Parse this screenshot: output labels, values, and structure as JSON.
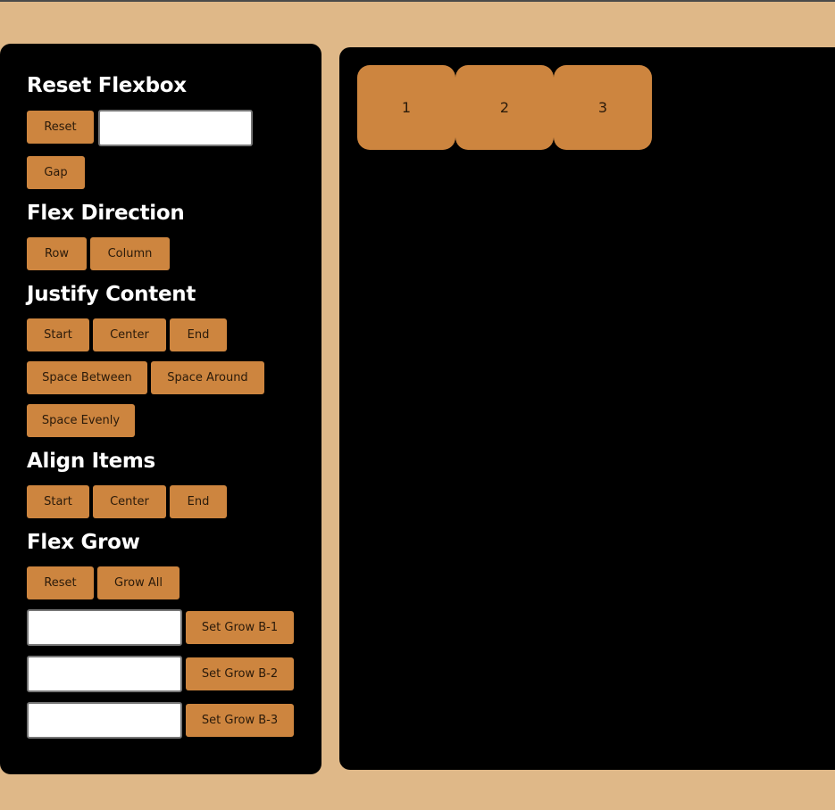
{
  "sections": {
    "reset": {
      "title": "Reset Flexbox",
      "reset_label": "Reset",
      "gap_value": "",
      "gap_label": "Gap"
    },
    "direction": {
      "title": "Flex Direction",
      "row_label": "Row",
      "column_label": "Column"
    },
    "justify": {
      "title": "Justify Content",
      "start_label": "Start",
      "center_label": "Center",
      "end_label": "End",
      "between_label": "Space Between",
      "around_label": "Space Around",
      "evenly_label": "Space Evenly"
    },
    "align": {
      "title": "Align Items",
      "start_label": "Start",
      "center_label": "Center",
      "end_label": "End"
    },
    "grow": {
      "title": "Flex Grow",
      "reset_label": "Reset",
      "grow_all_label": "Grow All",
      "b1_value": "",
      "b1_label": "Set Grow B-1",
      "b2_value": "",
      "b2_label": "Set Grow B-2",
      "b3_value": "",
      "b3_label": "Set Grow B-3"
    }
  },
  "boxes": [
    "1",
    "2",
    "3"
  ],
  "colors": {
    "page_background": "#dfb888",
    "panel_background": "#000000",
    "accent": "#cd853f",
    "heading_text": "#ffffff"
  }
}
